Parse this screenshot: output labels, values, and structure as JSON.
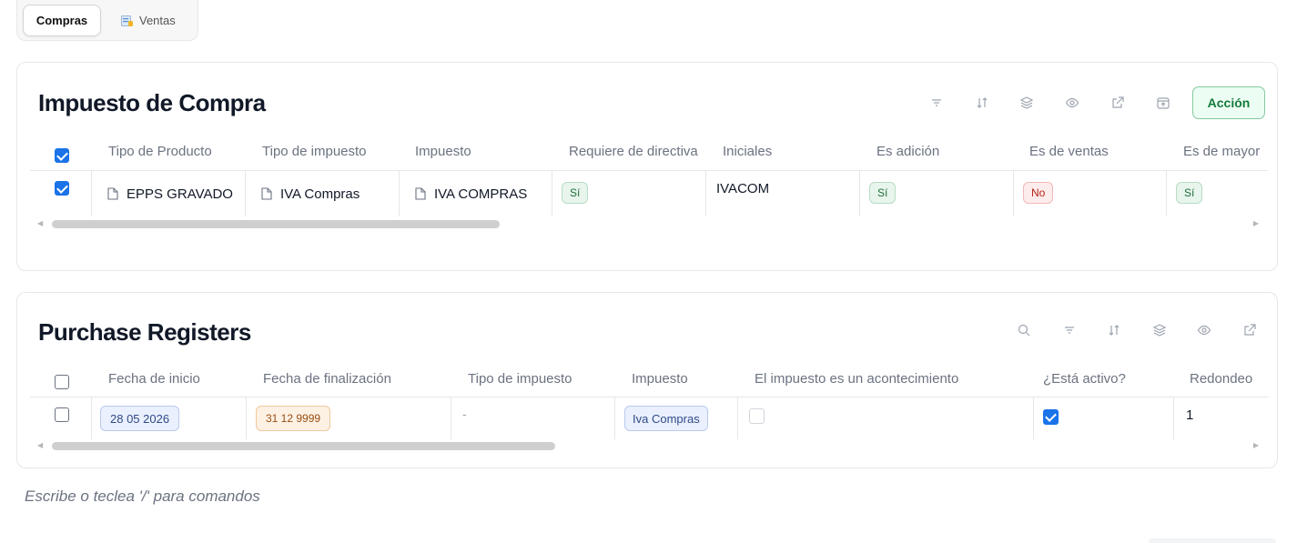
{
  "tabs": {
    "compras": "Compras",
    "ventas": "Ventas"
  },
  "impuesto_compra": {
    "title": "Impuesto de Compra",
    "action_label": "Acción",
    "headers": [
      "Tipo de Producto",
      "Tipo de impuesto",
      "Impuesto",
      "Requiere de directiva",
      "Iniciales",
      "Es adición",
      "Es de ventas",
      "Es de mayor"
    ],
    "row": {
      "tipo_producto": "EPPS GRAVADO",
      "tipo_impuesto": "IVA Compras",
      "impuesto": "IVA COMPRAS",
      "requiere_directiva": "Sí",
      "iniciales": "IVACOM",
      "es_adicion": "Sí",
      "es_ventas": "No",
      "es_mayor": "Sí",
      "selected": true
    }
  },
  "purchase_registers": {
    "title": "Purchase Registers",
    "headers": [
      "Fecha de inicio",
      "Fecha de finalización",
      "Tipo de impuesto",
      "Impuesto",
      "El impuesto es un acontecimiento",
      "¿Está activo?",
      "Redondeo"
    ],
    "row": {
      "fecha_inicio": "28 05 2026",
      "fecha_finalizacion": "31 12 9999",
      "tipo_impuesto": "-",
      "impuesto": "Iva Compras",
      "es_acontecimiento": false,
      "esta_activo": true,
      "redondeo": "1"
    }
  },
  "footer": {
    "placeholder": "Escribe o teclea '/' para comandos"
  },
  "colors": {
    "accent": "#1a73e8",
    "action_green": "#137a3c",
    "yes_bg": "#e8f5ec",
    "no_bg": "#fdecec"
  }
}
